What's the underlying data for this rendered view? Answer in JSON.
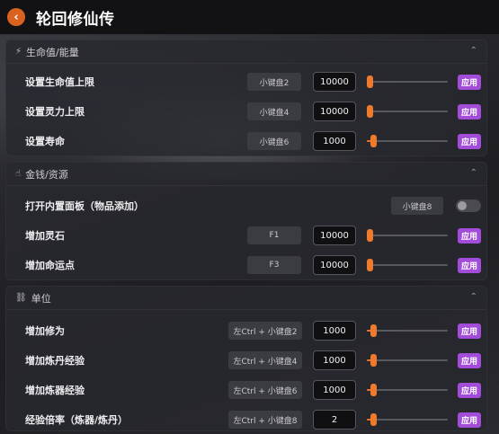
{
  "app": {
    "title": "轮回修仙传"
  },
  "sections": [
    {
      "title": "生命值/能量",
      "icon": "⚡",
      "rows": [
        {
          "label": "设置生命值上限",
          "hotkey": "小键盘2",
          "value": "10000",
          "slider_fraction": 0.0,
          "action": "应用"
        },
        {
          "label": "设置灵力上限",
          "hotkey": "小键盘4",
          "value": "10000",
          "slider_fraction": 0.0,
          "action": "应用"
        },
        {
          "label": "设置寿命",
          "hotkey": "小键盘6",
          "value": "1000",
          "slider_fraction": 0.05,
          "action": "应用"
        }
      ]
    },
    {
      "title": "金钱/资源",
      "icon": "👆",
      "rows": [
        {
          "label": "打开内置面板（物品添加）",
          "hotkey": "小键盘8",
          "toggle": false
        },
        {
          "label": "增加灵石",
          "hotkey": "F1",
          "value": "10000",
          "slider_fraction": 0.0,
          "action": "应用"
        },
        {
          "label": "增加命运点",
          "hotkey": "F3",
          "value": "10000",
          "slider_fraction": 0.0,
          "action": "应用"
        }
      ]
    },
    {
      "title": "单位",
      "icon": "⛓",
      "rows": [
        {
          "label": "增加修为",
          "hotkey": "左Ctrl + 小键盘2",
          "value": "1000",
          "slider_fraction": 0.05,
          "action": "应用"
        },
        {
          "label": "增加炼丹经验",
          "hotkey": "左Ctrl + 小键盘4",
          "value": "1000",
          "slider_fraction": 0.05,
          "action": "应用"
        },
        {
          "label": "增加炼器经验",
          "hotkey": "左Ctrl + 小键盘6",
          "value": "1000",
          "slider_fraction": 0.05,
          "action": "应用"
        },
        {
          "label": "经验倍率（炼器/炼丹）",
          "hotkey": "左Ctrl + 小键盘8",
          "value": "2",
          "slider_fraction": 0.05,
          "action": "应用"
        }
      ]
    }
  ],
  "colors": {
    "accent": "#f07a2c",
    "apply": "#a24cd9",
    "back": "#d9621f"
  },
  "icons": {
    "back": "arrow-left-icon",
    "collapse": "chevron-up-icon"
  }
}
